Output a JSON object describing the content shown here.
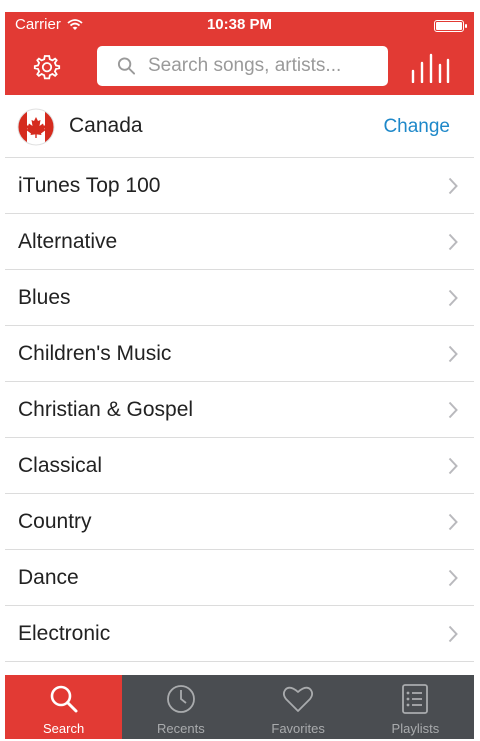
{
  "status_bar": {
    "carrier": "Carrier",
    "time": "10:38 PM"
  },
  "header": {
    "search_placeholder": "Search songs, artists...",
    "accent_color": "#e23a34"
  },
  "country": {
    "name": "Canada",
    "action": "Change"
  },
  "genres": [
    "iTunes Top 100",
    "Alternative",
    "Blues",
    "Children's Music",
    "Christian & Gospel",
    "Classical",
    "Country",
    "Dance",
    "Electronic"
  ],
  "tabs": [
    {
      "label": "Search",
      "icon": "search-icon",
      "active": true
    },
    {
      "label": "Recents",
      "icon": "clock-icon",
      "active": false
    },
    {
      "label": "Favorites",
      "icon": "heart-icon",
      "active": false
    },
    {
      "label": "Playlists",
      "icon": "list-icon",
      "active": false
    }
  ]
}
